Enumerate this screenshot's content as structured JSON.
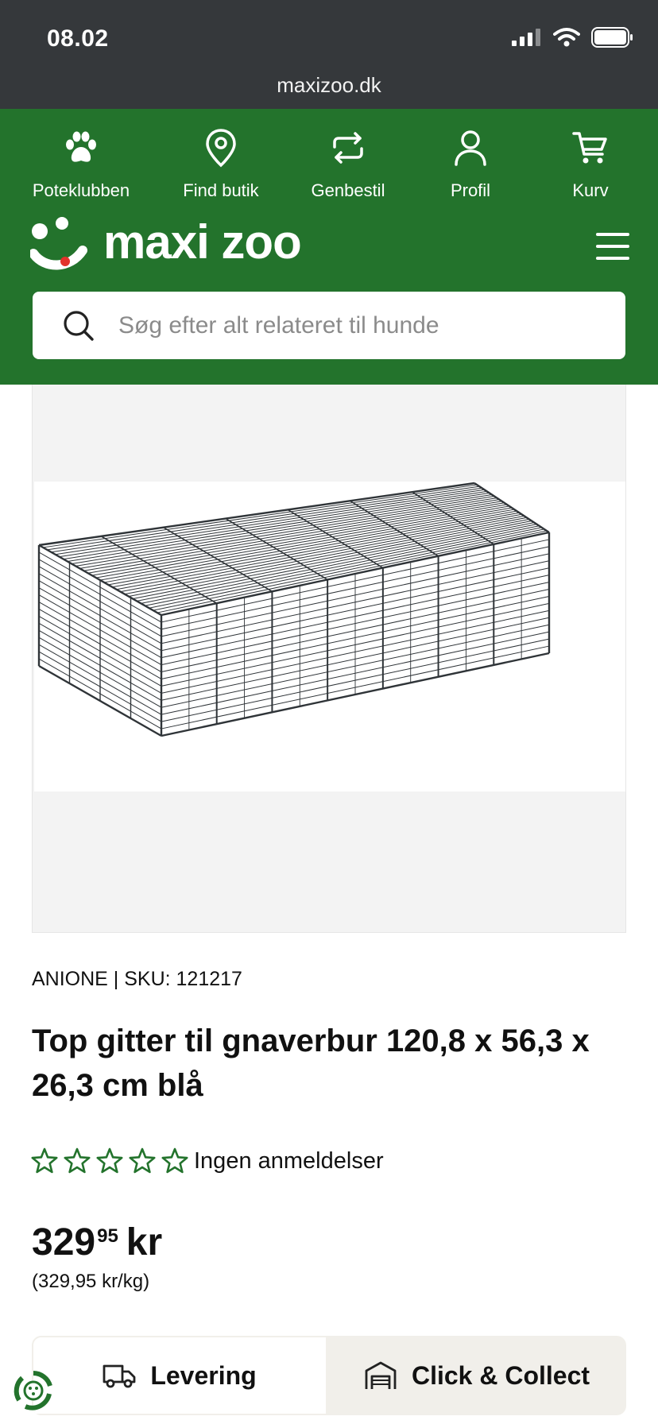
{
  "status_bar": {
    "time": "08.02",
    "url": "maxizoo.dk"
  },
  "quicknav": [
    {
      "label": "Poteklubben",
      "icon": "paw-icon"
    },
    {
      "label": "Find butik",
      "icon": "location-pin-icon"
    },
    {
      "label": "Genbestil",
      "icon": "reorder-icon"
    },
    {
      "label": "Profil",
      "icon": "user-icon"
    },
    {
      "label": "Kurv",
      "icon": "cart-icon"
    }
  ],
  "brand": {
    "logo_text": "maxi zoo"
  },
  "search": {
    "placeholder": "Søg efter alt relateret til hunde"
  },
  "product": {
    "brand_sku": "ANIONE | SKU: 121217",
    "title": "Top gitter til gnaverbur 120,8 x 56,3 x 26,3 cm blå",
    "rating_stars": 0,
    "reviews_text": "Ingen anmeldelser",
    "price_main": "329",
    "price_decimals": "95",
    "price_currency": "kr",
    "unit_price": "(329,95 kr/kg)"
  },
  "delivery": {
    "delivery_label": "Levering",
    "collect_label": "Click & Collect"
  },
  "colors": {
    "header_green": "#23732c",
    "status_bar": "#35383b",
    "star_green": "#23732c"
  }
}
